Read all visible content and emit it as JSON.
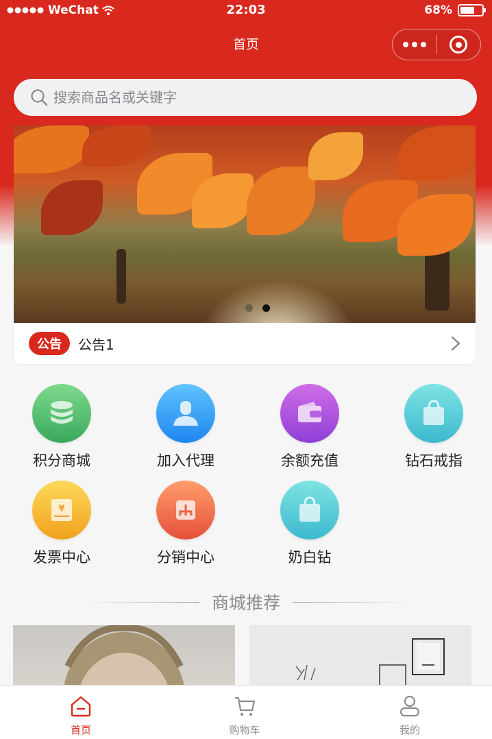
{
  "status_bar": {
    "carrier": "WeChat",
    "time": "22:03",
    "battery_text": "68%",
    "battery_level": 0.68
  },
  "nav": {
    "title": "首页"
  },
  "search": {
    "placeholder": "搜索商品名或关键字"
  },
  "banner": {
    "slide_count": 2,
    "active_slide": 2
  },
  "notice": {
    "tag": "公告",
    "text": "公告1"
  },
  "menu": [
    {
      "label": "积分商城",
      "icon": "database-coins-icon",
      "color_from": "#7ed98c",
      "color_to": "#39a95c"
    },
    {
      "label": "加入代理",
      "icon": "agent-person-icon",
      "color_from": "#62c3ff",
      "color_to": "#1d86f0"
    },
    {
      "label": "余额充值",
      "icon": "wallet-icon",
      "color_from": "#d06ee6",
      "color_to": "#8e3fd6"
    },
    {
      "label": "钻石戒指",
      "icon": "shopping-bag-icon",
      "color_from": "#7fe3e3",
      "color_to": "#3cb9cf"
    },
    {
      "label": "发票中心",
      "icon": "invoice-yen-icon",
      "color_from": "#ffd95a",
      "color_to": "#f1a11c"
    },
    {
      "label": "分销中心",
      "icon": "distribution-icon",
      "color_from": "#ff9e6b",
      "color_to": "#e5503a"
    },
    {
      "label": "奶白钻",
      "icon": "shopping-bag-icon",
      "color_from": "#7fe3e3",
      "color_to": "#3cb9cf"
    }
  ],
  "section": {
    "title": "商城推荐"
  },
  "tabbar": {
    "items": [
      {
        "label": "首页",
        "icon": "home-icon",
        "active": true
      },
      {
        "label": "购物车",
        "icon": "cart-icon",
        "active": false
      },
      {
        "label": "我的",
        "icon": "user-icon",
        "active": false
      }
    ]
  },
  "colors": {
    "brand_red": "#d9291f",
    "background": "#f6f6f7",
    "inactive_gray": "#8b8b8b"
  }
}
